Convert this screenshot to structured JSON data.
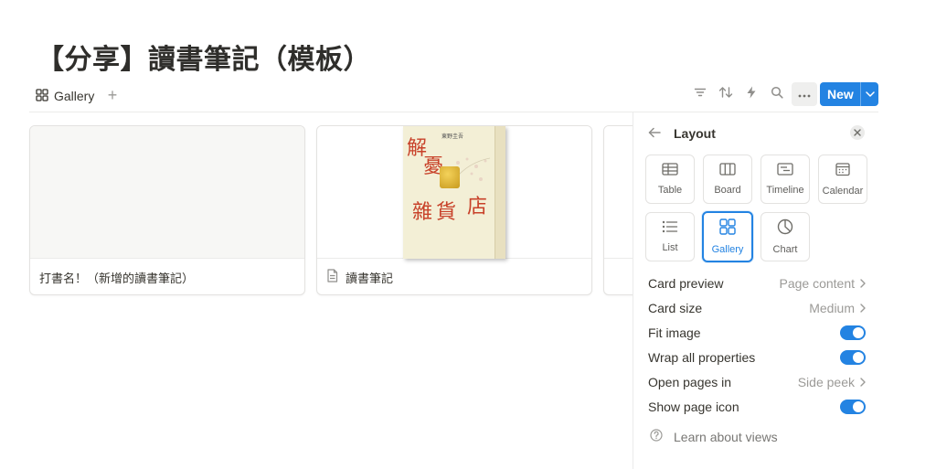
{
  "page": {
    "title": "【分享】讀書筆記（模板）"
  },
  "viewbar": {
    "active_view": {
      "label": "Gallery",
      "icon": "gallery-icon"
    },
    "add_view_icon": "plus-icon",
    "tools": [
      "filter-icon",
      "sort-icon",
      "lightning-icon",
      "search-icon",
      "more-icon"
    ],
    "new_button": {
      "label": "New",
      "color": "#2383e2"
    }
  },
  "cards": [
    {
      "title": "打書名！（新增的讀書筆記）",
      "has_cover": false,
      "icon": null
    },
    {
      "title": "讀書筆記",
      "has_cover": true,
      "icon": "page-icon"
    }
  ],
  "book_cover": {
    "author": "東野圭吾",
    "title_chars": [
      "解",
      "憂",
      "雜",
      "貨",
      "店"
    ]
  },
  "layout_panel": {
    "title": "Layout",
    "options": [
      {
        "label": "Table",
        "icon": "table-icon",
        "active": false
      },
      {
        "label": "Board",
        "icon": "board-icon",
        "active": false
      },
      {
        "label": "Timeline",
        "icon": "timeline-icon",
        "active": false
      },
      {
        "label": "Calendar",
        "icon": "calendar-icon",
        "active": false
      },
      {
        "label": "List",
        "icon": "list-icon",
        "active": false
      },
      {
        "label": "Gallery",
        "icon": "gallery-icon",
        "active": true
      },
      {
        "label": "Chart",
        "icon": "chart-icon",
        "active": false
      }
    ],
    "settings": [
      {
        "label": "Card preview",
        "value": "Page content",
        "type": "select"
      },
      {
        "label": "Card size",
        "value": "Medium",
        "type": "select"
      },
      {
        "label": "Fit image",
        "value": true,
        "type": "toggle"
      },
      {
        "label": "Wrap all properties",
        "value": true,
        "type": "toggle"
      },
      {
        "label": "Open pages in",
        "value": "Side peek",
        "type": "select"
      },
      {
        "label": "Show page icon",
        "value": true,
        "type": "toggle"
      }
    ],
    "learn_link": "Learn about views",
    "accent_color": "#2383e2"
  }
}
